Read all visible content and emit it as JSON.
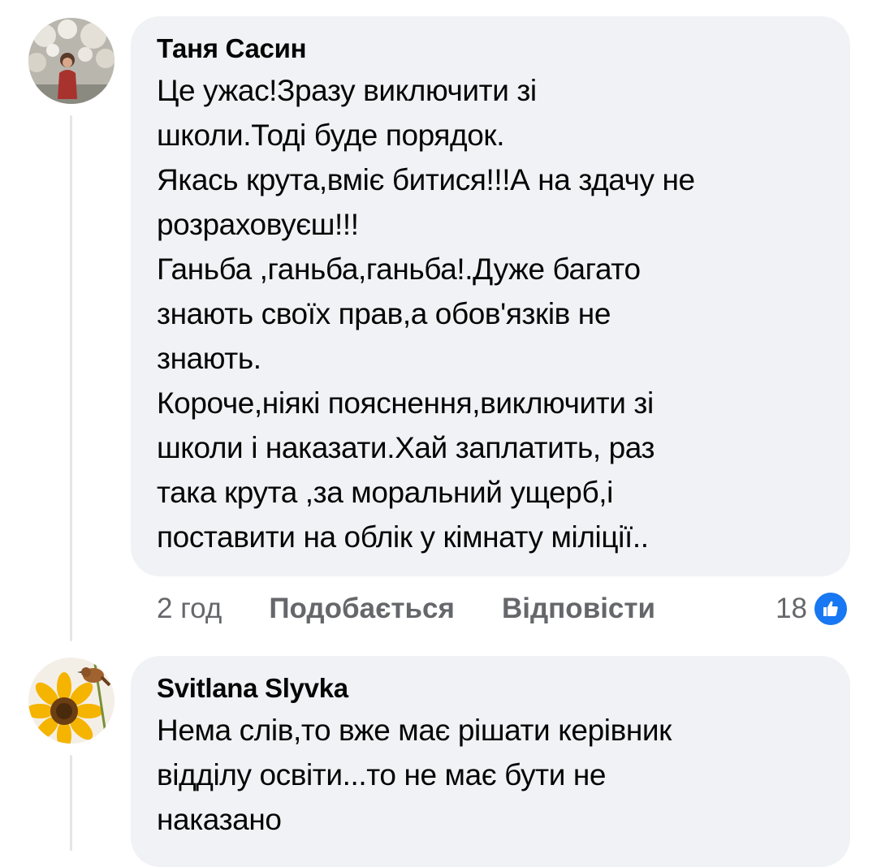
{
  "comments": [
    {
      "author": "Таня Сасин",
      "text": "Це ужас!Зразу виключити зі\nшколи.Тоді буде порядок.\nЯкась крута,вміє битися!!!А на здачу не\nрозраховуєш!!!\nГаньба ,ганьба,ганьба!.Дуже багато\nзнають своїх прав,а обов'язків не\nзнають.\nКороче,ніякі пояснення,виключити зі\nшколи і наказати.Хай заплатить, раз\nтака крута ,за моральний ущерб,і\nпоставити на облік у кімнату міліції..",
      "time": "2 год",
      "like_label": "Подобається",
      "reply_label": "Відповісти",
      "reaction_count": "18",
      "reaction_icon": "like-thumb-icon",
      "avatar_icon": "user-photo-avatar"
    },
    {
      "author": "Svitlana Slyvka",
      "text": "Нема слів,то вже має рішати керівник\nвідділу освіти...то не має бути не\nнаказано",
      "avatar_icon": "sunflower-bird-avatar"
    }
  ],
  "colors": {
    "bubble": "#f0f2f5",
    "meta_text": "#65676b",
    "like_blue": "#1877f2"
  }
}
